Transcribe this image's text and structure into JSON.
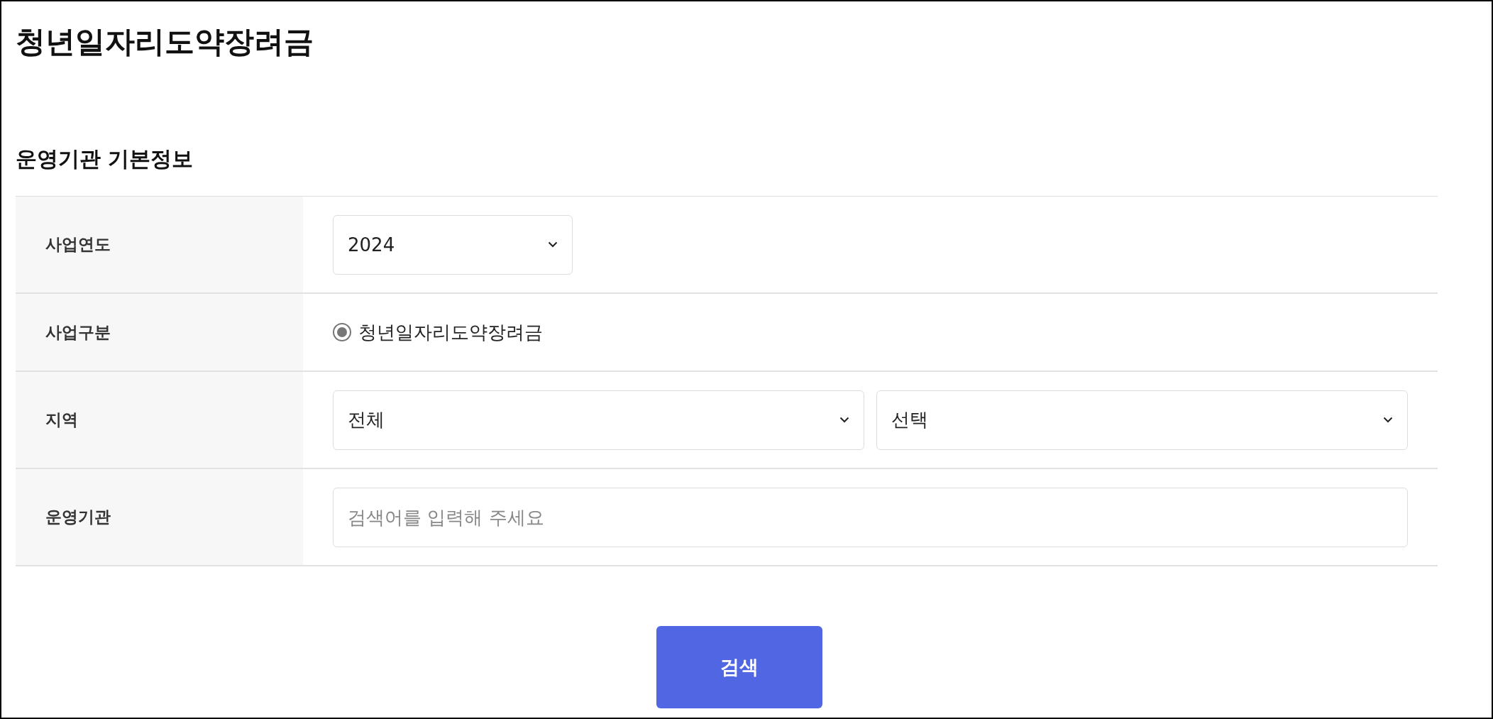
{
  "page_title": "청년일자리도약장려금",
  "section_title": "운영기관 기본정보",
  "form": {
    "rows": [
      {
        "kind": "select",
        "label": "사업연도",
        "selects": [
          {
            "value": "2024"
          }
        ]
      },
      {
        "kind": "radio",
        "label": "사업구분",
        "options": [
          {
            "label": "청년일자리도약장려금",
            "selected": true
          }
        ]
      },
      {
        "kind": "select",
        "label": "지역",
        "selects": [
          {
            "value": "전체"
          },
          {
            "value": "선택"
          }
        ]
      },
      {
        "kind": "text",
        "label": "운영기관",
        "placeholder": "검색어를 입력해 주세요"
      }
    ]
  },
  "search_button": "검색"
}
